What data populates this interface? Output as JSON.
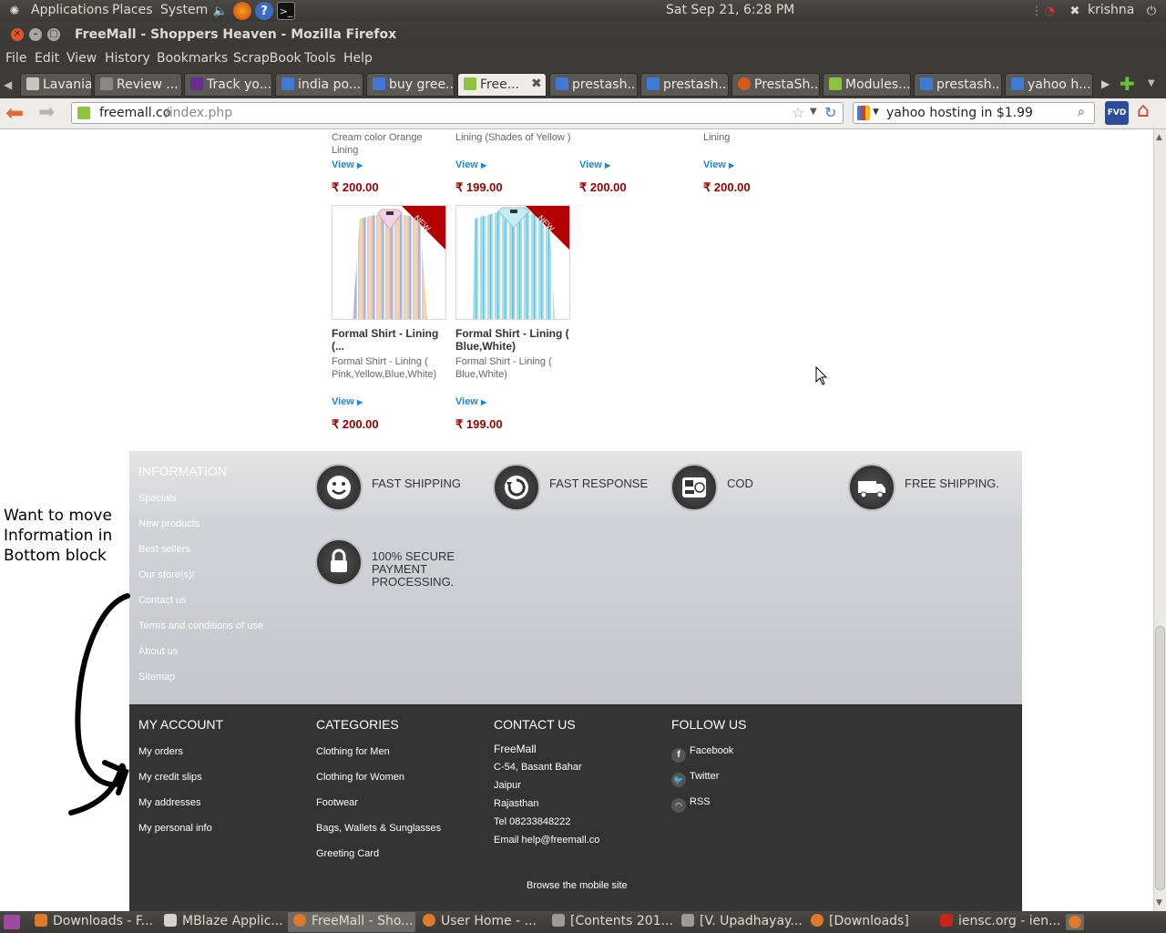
{
  "top_panel": {
    "applications": "Applications",
    "places": "Places",
    "system": "System",
    "clock": "Sat Sep 21,  6:28 PM",
    "user": "krishna"
  },
  "window": {
    "title": "FreeMall - Shoppers Heaven - Mozilla Firefox"
  },
  "menu": [
    "File",
    "Edit",
    "View",
    "History",
    "Bookmarks",
    "ScrapBook",
    "Tools",
    "Help"
  ],
  "tabs": [
    {
      "label": "Lavania ...",
      "icon": "page-icon",
      "color": "#c9c6be"
    },
    {
      "label": "Review ...",
      "icon": "page-icon",
      "color": "#8a8882"
    },
    {
      "label": "Track yo...",
      "icon": "fedex-icon",
      "color": "#6a2d91"
    },
    {
      "label": "india po...",
      "icon": "google-icon",
      "color": "#3f79d8"
    },
    {
      "label": "buy gree...",
      "icon": "google-icon",
      "color": "#3f79d8"
    },
    {
      "label": "Free...",
      "icon": "freemall-icon",
      "color": "#8fc23f",
      "active": true
    },
    {
      "label": "prestash...",
      "icon": "google-icon",
      "color": "#3f79d8"
    },
    {
      "label": "prestash...",
      "icon": "google-icon",
      "color": "#3f79d8"
    },
    {
      "label": "PrestaSh...",
      "icon": "loading-icon",
      "color": "#d65a1d"
    },
    {
      "label": "Modules...",
      "icon": "prestashop-icon",
      "color": "#8fc23f"
    },
    {
      "label": "prestash...",
      "icon": "google-icon",
      "color": "#3f79d8"
    },
    {
      "label": "yahoo h...",
      "icon": "google-icon",
      "color": "#3f79d8"
    }
  ],
  "nav": {
    "url_host": "freemall.co",
    "url_path": "/index.php",
    "search_value": "yahoo hosting in $1.99"
  },
  "products_top": [
    {
      "desc": "Cream color Orange Lining",
      "view": "View",
      "price": "₹ 200.00"
    },
    {
      "desc": "Lining (Shades of Yellow )",
      "view": "View",
      "price": "₹ 199.00"
    },
    {
      "desc": "",
      "view": "View",
      "price": "₹ 200.00"
    },
    {
      "desc": "Lining",
      "view": "View",
      "price": "₹ 200.00"
    }
  ],
  "products": [
    {
      "badge": "NEW",
      "name": "Formal Shirt - Lining (...",
      "desc": "Formal Shirt - Lining ( Pink,Yellow,Blue,White)",
      "view": "View",
      "price": "₹ 200.00"
    },
    {
      "badge": "NEW",
      "name": "Formal Shirt - Lining ( Blue,White)",
      "desc": "Formal Shirt - Lining ( Blue,White)",
      "view": "View",
      "price": "₹ 199.00"
    }
  ],
  "information": {
    "title": "INFORMATION",
    "links": [
      "Specials",
      "New products",
      "Best sellers",
      "Our store(s)!",
      "Contact us",
      "Terms and conditions of use",
      "About us",
      "Sitemap"
    ]
  },
  "features": [
    {
      "label": "FAST SHIPPING",
      "icon": "smiley-icon"
    },
    {
      "label": "FAST RESPONSE",
      "icon": "refresh-icon"
    },
    {
      "label": "COD",
      "icon": "cash-register-icon"
    },
    {
      "label": "FREE SHIPPING.",
      "icon": "truck-icon"
    },
    {
      "label": "100% SECURE PAYMENT PROCESSING.",
      "icon": "lock-icon"
    }
  ],
  "footer": {
    "my_account": {
      "title": "MY ACCOUNT",
      "links": [
        "My orders",
        "My credit slips",
        "My addresses",
        "My personal info"
      ]
    },
    "categories": {
      "title": "CATEGORIES",
      "links": [
        "Clothing for Men",
        "Clothing for Women",
        "Footwear",
        "Bags, Wallets & Sunglasses",
        "Greeting Card"
      ]
    },
    "contact": {
      "title": "CONTACT US",
      "company": "FreeMall",
      "lines": [
        "C-54, Basant Bahar",
        "Jaipur",
        "Rajasthan",
        "Tel 08233848222",
        "Email help@freemall.co"
      ]
    },
    "follow": {
      "title": "FOLLOW US",
      "links": [
        {
          "label": "Facebook",
          "icon": "facebook-icon"
        },
        {
          "label": "Twitter",
          "icon": "twitter-icon"
        },
        {
          "label": "RSS",
          "icon": "rss-icon"
        }
      ]
    },
    "mobile": "Browse the mobile site"
  },
  "annotation": {
    "lines": [
      "Want to move",
      "Information in",
      "Bottom block"
    ]
  },
  "taskbar": [
    {
      "label": "Downloads - F...",
      "icon": "firefox-downloads-icon"
    },
    {
      "label": "MBlaze Applic...",
      "icon": "window-icon"
    },
    {
      "label": "FreeMall - Sho...",
      "icon": "firefox-icon",
      "active": true
    },
    {
      "label": "User Home - ...",
      "icon": "firefox-icon"
    },
    {
      "label": "[Contents 201...",
      "icon": "window-icon"
    },
    {
      "label": "[V. Upadhayay...",
      "icon": "window-icon"
    },
    {
      "label": "[Downloads]",
      "icon": "firefox-icon"
    },
    {
      "label": "iensc.org - ien...",
      "icon": "filezilla-icon"
    }
  ],
  "colors": {
    "price": "#990000",
    "link": "#1a8bd3",
    "footer_bg": "#333333",
    "badge": "#b30000"
  }
}
